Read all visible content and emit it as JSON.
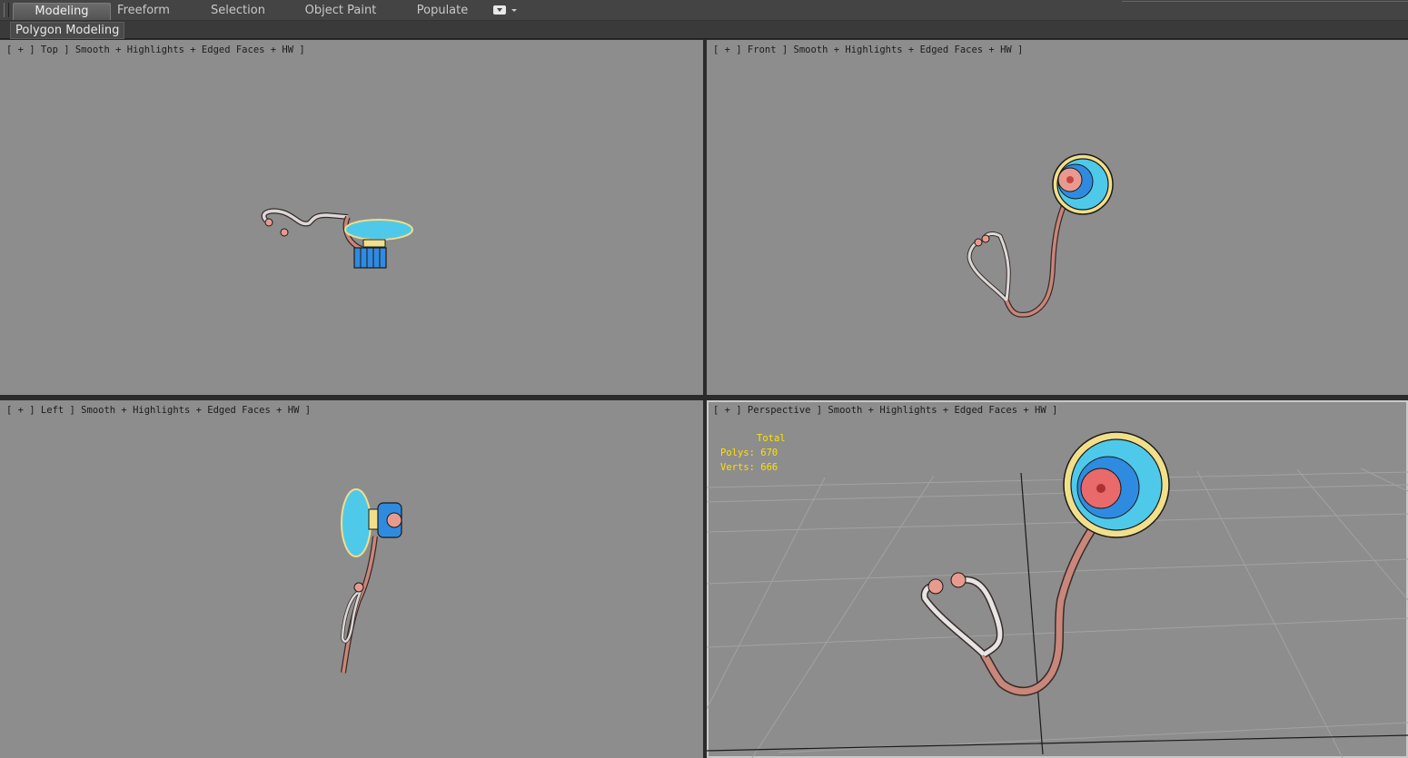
{
  "ribbon": {
    "tabs": [
      {
        "label": "Modeling",
        "active": true
      },
      {
        "label": "Freeform",
        "active": false
      },
      {
        "label": "Selection",
        "active": false
      },
      {
        "label": "Object Paint",
        "active": false
      },
      {
        "label": "Populate",
        "active": false
      }
    ],
    "dropdown_icon": "display-options-icon",
    "panel": {
      "label": "Polygon Modeling"
    }
  },
  "viewports": {
    "top": {
      "label": "[ + ] Top ] Smooth + Highlights + Edged Faces + HW ]"
    },
    "front": {
      "label": "[ + ] Front ] Smooth + Highlights + Edged Faces + HW ]"
    },
    "left": {
      "label": "[ + ] Left ] Smooth + Highlights + Edged Faces + HW ]"
    },
    "perspective": {
      "label": "[ + ] Perspective ] Smooth + Highlights + Edged Faces + HW ]",
      "active": true,
      "stats": {
        "header": "Total",
        "polys": "Polys: 670",
        "verts": "Verts: 666"
      }
    }
  },
  "colors": {
    "viewport_bg": "#8d8d8d",
    "ui_bg": "#444444",
    "stats_text": "#ffe000",
    "tube": "#c8877a",
    "chestpiece": "#4fc9ea",
    "rim": "#f2df8a",
    "earpiece": "#e89a8f"
  }
}
